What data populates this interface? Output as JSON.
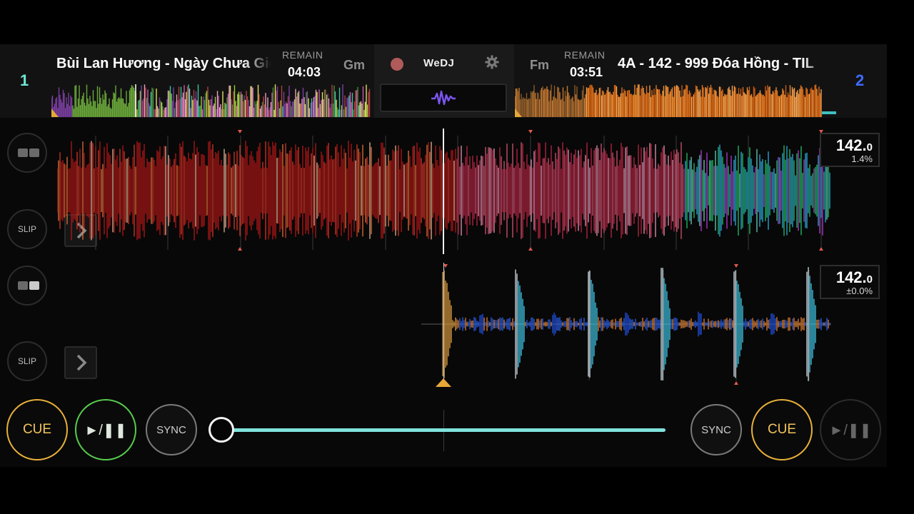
{
  "app": {
    "name": "WeDJ"
  },
  "deck1": {
    "number": "1",
    "title": "Bùi Lan Hương - Ngày Chưa Giông Bão",
    "remain_label": "REMAIN",
    "remain_time": "04:03",
    "key": "Gm",
    "bpm": "142.",
    "bpm_decimal": "0",
    "pitch": "1.4%",
    "slip_label": "SLIP",
    "cue_label": "CUE",
    "play_label": "►/❚❚",
    "sync_label": "SYNC",
    "playing": true
  },
  "deck2": {
    "number": "2",
    "title": "4A - 142 - 999 Đóa Hồng - TIL",
    "remain_label": "REMAIN",
    "remain_time": "03:51",
    "key": "Fm",
    "bpm": "142.",
    "bpm_decimal": "0",
    "pitch": "±0.0%",
    "slip_label": "SLIP",
    "cue_label": "CUE",
    "play_label": "►/❚❚",
    "sync_label": "SYNC",
    "playing": false
  },
  "crossfader": {
    "position": 0.0
  },
  "colors": {
    "deck1_accent": "#6ee6d6",
    "deck2_accent": "#3e6bff",
    "cue": "#e8b038",
    "play": "#56cc4c",
    "crossfader": "#7fe3dc"
  },
  "icons": {
    "record": "record-icon",
    "settings": "gear-icon",
    "waveform": "waveform-icon",
    "next": "chevron-right-icon"
  }
}
